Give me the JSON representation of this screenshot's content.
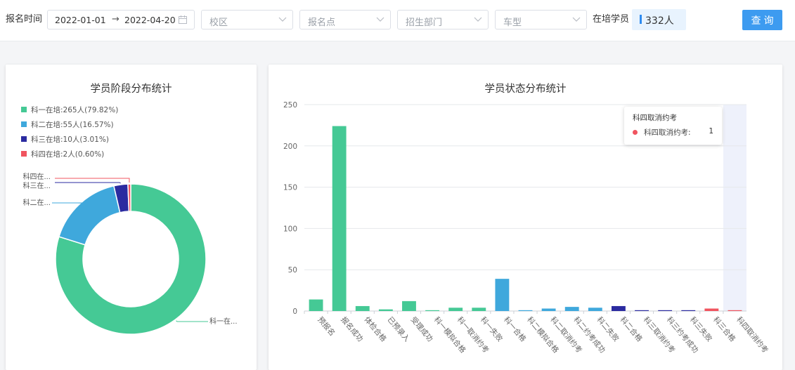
{
  "filters": {
    "date_label": "报名时间",
    "date_start": "2022-01-01",
    "date_sep": "→",
    "date_end": "2022-04-20",
    "campus_placeholder": "校区",
    "site_placeholder": "报名点",
    "dept_placeholder": "招生部门",
    "car_placeholder": "车型",
    "enrolled_label": "在培学员",
    "enrolled_count": "332人",
    "query_label": "查询"
  },
  "colors": {
    "green": "#45c995",
    "blue": "#3fa8dc",
    "indigo": "#2b2ba0",
    "red": "#f0545f",
    "primary": "#3d9bf0"
  },
  "pie": {
    "title": "学员阶段分布统计",
    "legend": [
      {
        "label": "科一在培:265人(79.82%)",
        "color": "#45c995"
      },
      {
        "label": "科二在培:55人(16.57%)",
        "color": "#3fa8dc"
      },
      {
        "label": "科三在培:10人(3.01%)",
        "color": "#2b2ba0"
      },
      {
        "label": "科四在培:2人(0.60%)",
        "color": "#f0545f"
      }
    ],
    "slice_labels": [
      "科一在...",
      "科二在...",
      "科三在...",
      "科四在..."
    ]
  },
  "bar": {
    "title": "学员状态分布统计",
    "tooltip": {
      "title": "科四取消约考",
      "series": "科四取消约考:",
      "value": "1"
    }
  },
  "chart_data": [
    {
      "type": "pie",
      "title": "学员阶段分布统计",
      "categories": [
        "科一在培",
        "科二在培",
        "科三在培",
        "科四在培"
      ],
      "values": [
        265,
        55,
        10,
        2
      ],
      "percentages": [
        79.82,
        16.57,
        3.01,
        0.6
      ],
      "style": "donut",
      "legend_position": "top-left"
    },
    {
      "type": "bar",
      "title": "学员状态分布统计",
      "categories": [
        "预报名",
        "报名成功",
        "体检合格",
        "已预录入",
        "受理成功",
        "科一模拟合格",
        "科一取消约考",
        "科一失败",
        "科一合格",
        "科二模拟合格",
        "科二取消约考",
        "科二约考成功",
        "科二失败",
        "科二合格",
        "科三取消约考",
        "科三约考成功",
        "科三失败",
        "科三合格",
        "科四取消约考"
      ],
      "values": [
        14,
        224,
        6,
        2,
        12,
        1,
        4,
        4,
        39,
        1,
        3,
        5,
        4,
        6,
        1,
        1,
        1,
        3,
        1
      ],
      "bar_colors": [
        "#45c995",
        "#45c995",
        "#45c995",
        "#45c995",
        "#45c995",
        "#45c995",
        "#45c995",
        "#45c995",
        "#3fa8dc",
        "#3fa8dc",
        "#3fa8dc",
        "#3fa8dc",
        "#3fa8dc",
        "#2b2ba0",
        "#2b2ba0",
        "#2b2ba0",
        "#2b2ba0",
        "#f0545f",
        "#f0545f"
      ],
      "yticks": [
        0,
        50,
        100,
        150,
        200,
        250
      ],
      "ylim": [
        0,
        250
      ],
      "grid": true,
      "highlighted_category": "科四取消约考"
    }
  ]
}
